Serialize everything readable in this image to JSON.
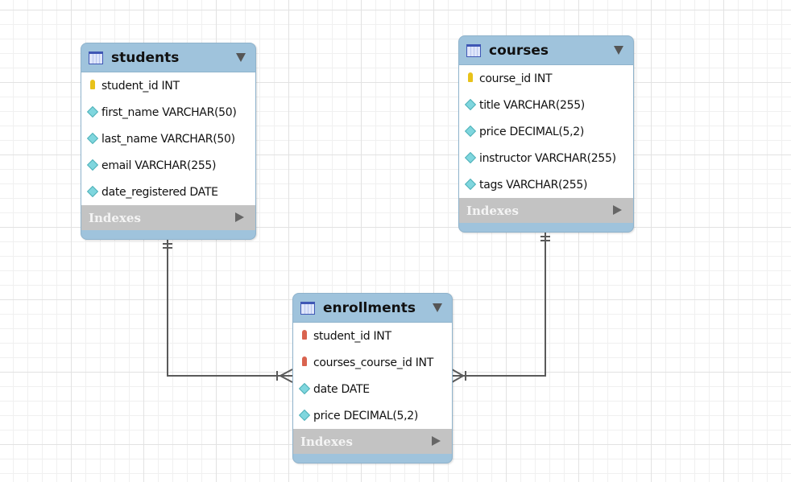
{
  "tables": [
    {
      "name": "students",
      "columns": [
        {
          "text": "student_id INT",
          "icon": "primary-key-icon",
          "color": "#e8c21a"
        },
        {
          "text": "first_name VARCHAR(50)",
          "icon": "column-icon"
        },
        {
          "text": "last_name VARCHAR(50)",
          "icon": "column-icon"
        },
        {
          "text": "email VARCHAR(255)",
          "icon": "column-icon"
        },
        {
          "text": "date_registered DATE",
          "icon": "column-icon"
        }
      ],
      "indexes": "Indexes"
    },
    {
      "name": "courses",
      "columns": [
        {
          "text": "course_id INT",
          "icon": "primary-key-icon",
          "color": "#e8c21a"
        },
        {
          "text": "title VARCHAR(255)",
          "icon": "column-icon"
        },
        {
          "text": "price DECIMAL(5,2)",
          "icon": "column-icon"
        },
        {
          "text": "instructor VARCHAR(255)",
          "icon": "column-icon"
        },
        {
          "text": "tags VARCHAR(255)",
          "icon": "column-icon"
        }
      ],
      "indexes": "Indexes"
    },
    {
      "name": "enrollments",
      "columns": [
        {
          "text": "student_id INT",
          "icon": "foreign-key-icon",
          "color": "#d9634f"
        },
        {
          "text": "courses_course_id INT",
          "icon": "foreign-key-icon",
          "color": "#d9634f"
        },
        {
          "text": "date DATE",
          "icon": "column-icon"
        },
        {
          "text": "price DECIMAL(5,2)",
          "icon": "column-icon"
        }
      ],
      "indexes": "Indexes"
    }
  ],
  "relationships": [
    {
      "from": "students",
      "to": "enrollments",
      "type": "one-to-many"
    },
    {
      "from": "courses",
      "to": "enrollments",
      "type": "one-to-many"
    }
  ],
  "colors": {
    "header": "#9fc3dc",
    "indexes": "#c3c3c3",
    "line": "#555555"
  }
}
